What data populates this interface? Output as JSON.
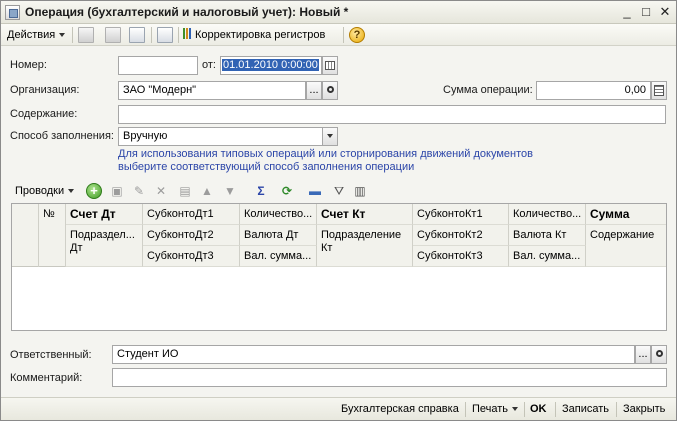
{
  "window": {
    "title": "Операция (бухгалтерский и налоговый учет): Новый *",
    "minimize": "_",
    "maximize": "□",
    "close": "✕"
  },
  "toolbar": {
    "actions_label": "Действия",
    "registers_label": "Корректировка регистров",
    "help_label": "?"
  },
  "form": {
    "number_label": "Номер:",
    "number_value": "",
    "date_label": "от:",
    "date_value": "01.01.2010  0:00:00",
    "org_label": "Организация:",
    "org_value": "ЗАО \"Модерн\"",
    "sum_label": "Сумма операции:",
    "sum_value": "0,00",
    "content_label": "Содержание:",
    "content_value": "",
    "fill_label": "Способ заполнения:",
    "fill_value": "Вручную",
    "hint_line1": "Для использования типовых операций или сторнирования движений документов",
    "hint_line2": "выберите соответствующий способ заполнения операции"
  },
  "entries": {
    "toolbar_label": "Проводки",
    "columns": {
      "num": "№",
      "acc_dt": "Счет Дт",
      "sub_dt1": "СубконтоДт1",
      "qty_dt": "Количество...",
      "acc_kt": "Счет Кт",
      "sub_kt1": "СубконтоКт1",
      "qty_kt": "Количество...",
      "sum": "Сумма",
      "div_dt": "Подраздел... Дт",
      "sub_dt2": "СубконтоДт2",
      "cur_dt": "Валюта Дт",
      "div_kt": "Подразделение Кт",
      "sub_kt2": "СубконтоКт2",
      "cur_kt": "Валюта Кт",
      "content": "Содержание",
      "sub_dt3": "СубконтоДт3",
      "cursum_dt": "Вал. сумма...",
      "sub_kt3": "СубконтоКт3",
      "cursum_kt": "Вал. сумма..."
    }
  },
  "footer_fields": {
    "responsible_label": "Ответственный:",
    "responsible_value": "Студент ИО",
    "comment_label": "Комментарий:",
    "comment_value": ""
  },
  "bottombar": {
    "report_label": "Бухгалтерская справка",
    "print_label": "Печать",
    "ok_label": "OK",
    "save_label": "Записать",
    "close_label": "Закрыть"
  }
}
